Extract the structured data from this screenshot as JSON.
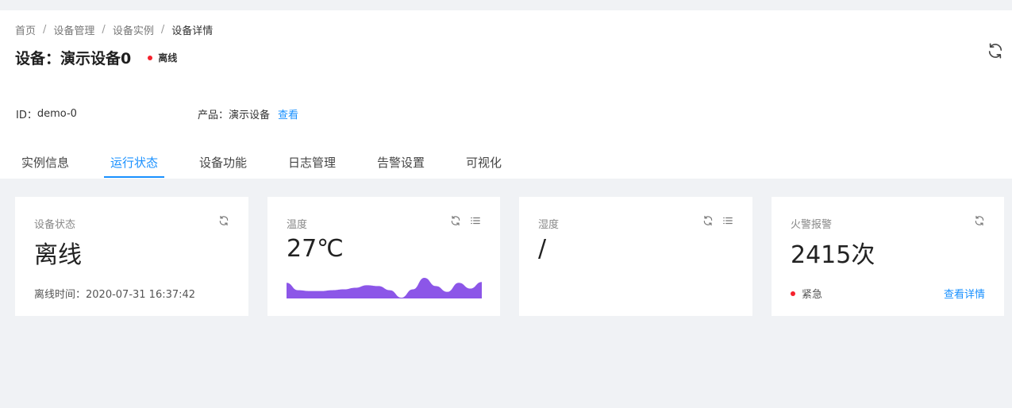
{
  "breadcrumb": [
    "首页",
    "设备管理",
    "设备实例",
    "设备详情"
  ],
  "breadcrumb_sep": "/",
  "title": "设备：演示设备0",
  "status": {
    "label": "离线",
    "color": "#f5222d"
  },
  "description": {
    "id_label": "ID：",
    "id_value": "demo-0",
    "product_label": "产品：",
    "product_value": "演示设备",
    "product_link": "查看"
  },
  "tabs": [
    {
      "label": "实例信息",
      "active": false
    },
    {
      "label": "运行状态",
      "active": true
    },
    {
      "label": "设备功能",
      "active": false
    },
    {
      "label": "日志管理",
      "active": false
    },
    {
      "label": "告警设置",
      "active": false
    },
    {
      "label": "可视化",
      "active": false
    }
  ],
  "cards": {
    "device_status": {
      "label": "设备状态",
      "value": "离线",
      "footer": "离线时间：2020-07-31 16:37:42"
    },
    "temperature": {
      "label": "温度",
      "value": "27℃",
      "spark_color": "#8c56e8",
      "spark_values": [
        19,
        10,
        9,
        9,
        10,
        11,
        13,
        16,
        15,
        10,
        1,
        11,
        25,
        15,
        8,
        19,
        12,
        20
      ]
    },
    "humidity": {
      "label": "湿度",
      "value": "/"
    },
    "fire_alarm": {
      "label": "火警报警",
      "value": "2415次",
      "level": "紧急",
      "link": "查看详情"
    }
  },
  "colors": {
    "accent": "#1890ff",
    "danger": "#f5222d",
    "page_bg": "#f0f2f5"
  },
  "icons": {
    "refresh": "refresh-icon",
    "list": "list-icon"
  }
}
